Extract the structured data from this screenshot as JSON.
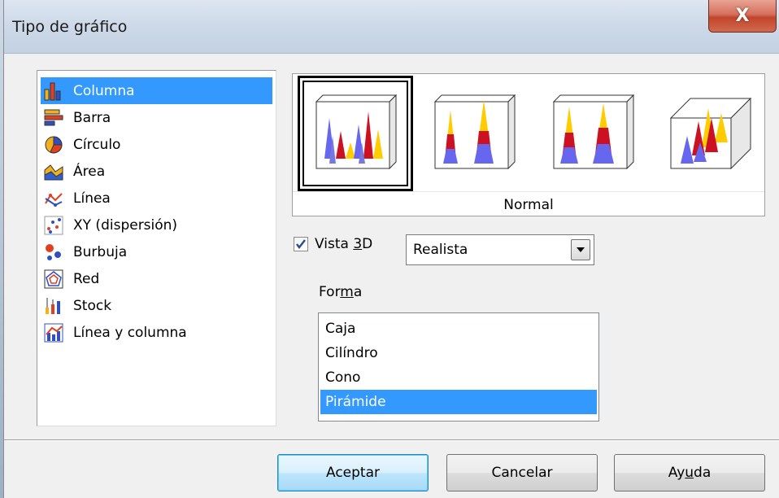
{
  "window": {
    "title": "Tipo de gráfico",
    "close_label": "X"
  },
  "chart_types": [
    {
      "label": "Columna",
      "icon": "column-chart-icon",
      "selected": true
    },
    {
      "label": "Barra",
      "icon": "bar-chart-icon"
    },
    {
      "label": "Círculo",
      "icon": "pie-chart-icon"
    },
    {
      "label": "Área",
      "icon": "area-chart-icon"
    },
    {
      "label": "Línea",
      "icon": "line-chart-icon"
    },
    {
      "label": "XY (dispersión)",
      "icon": "scatter-chart-icon"
    },
    {
      "label": "Burbuja",
      "icon": "bubble-chart-icon"
    },
    {
      "label": "Red",
      "icon": "net-chart-icon"
    },
    {
      "label": "Stock",
      "icon": "stock-chart-icon"
    },
    {
      "label": "Línea y columna",
      "icon": "line-column-chart-icon"
    }
  ],
  "variants": {
    "selected_label": "Normal",
    "selected_index": 0
  },
  "view3d": {
    "checked": true,
    "label_pre": "Vista ",
    "label_key": "3",
    "label_post": "D",
    "scheme_value": "Realista"
  },
  "shape": {
    "label_pre": "For",
    "label_key": "m",
    "label_post": "a",
    "options": [
      "Caja",
      "Cilíndro",
      "Cono",
      "Pirámide"
    ],
    "selected_index": 3
  },
  "buttons": {
    "ok": "Aceptar",
    "cancel": "Cancelar",
    "help_pre": "Ay",
    "help_key": "u",
    "help_post": "da"
  },
  "colors": {
    "selection": "#3399ff",
    "close_button": "#c2452c"
  }
}
